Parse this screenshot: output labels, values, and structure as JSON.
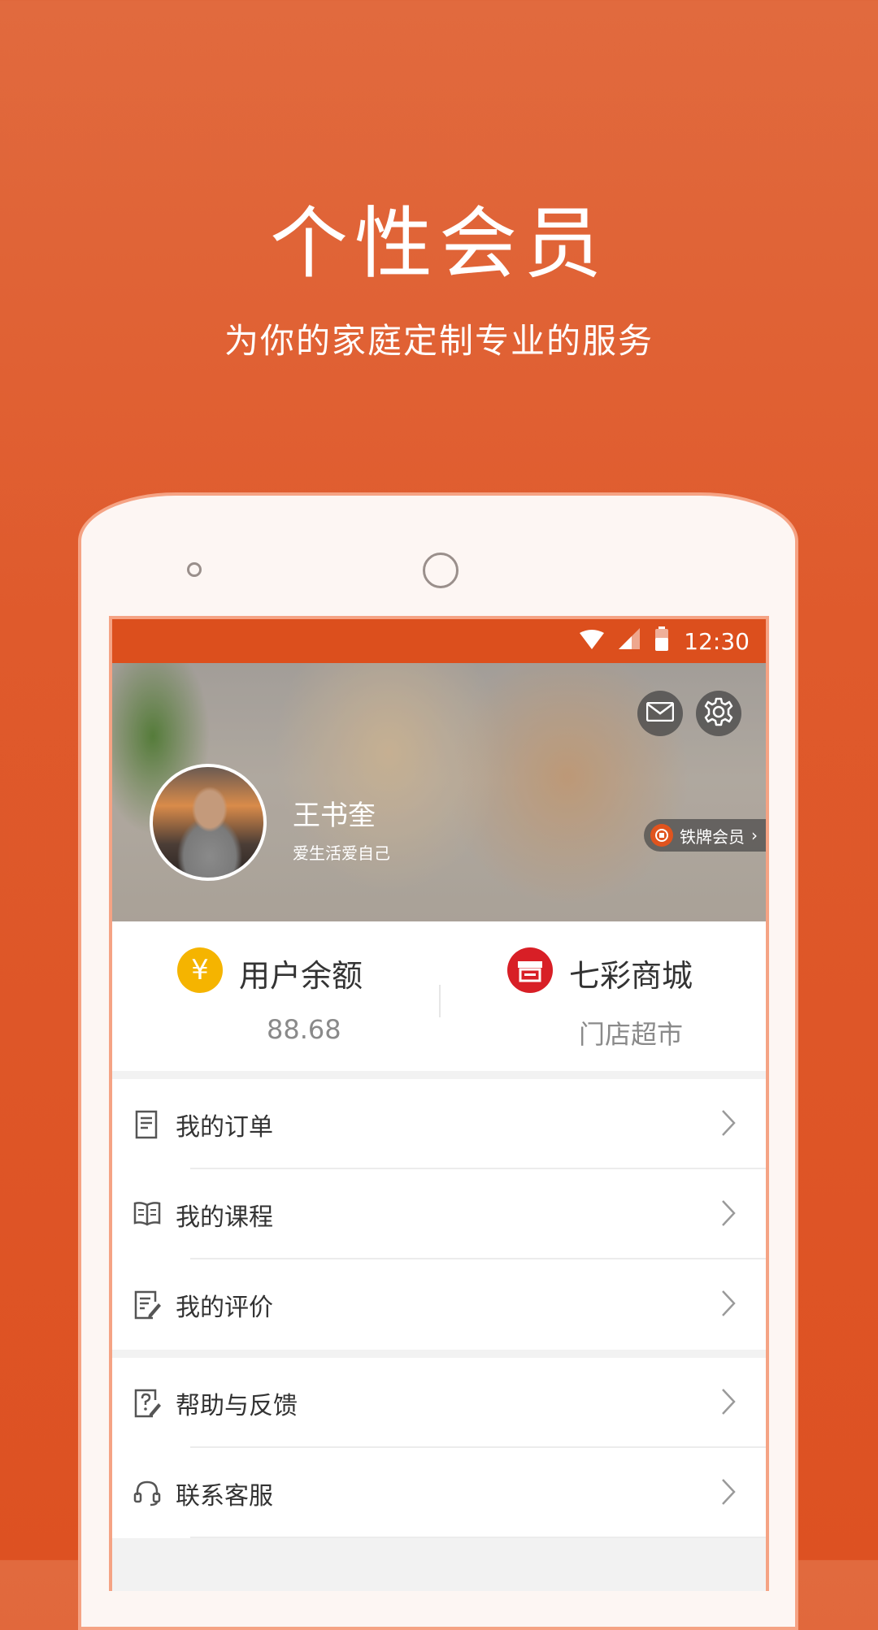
{
  "promo": {
    "title": "个性会员",
    "subtitle": "为你的家庭定制专业的服务"
  },
  "status_bar": {
    "time": "12:30"
  },
  "profile": {
    "name": "王书奎",
    "motto": "爱生活爱自己",
    "member_level": "铁牌会员",
    "member_chevron": "›"
  },
  "stats": {
    "balance": {
      "title": "用户余额",
      "value": "88.68",
      "icon": "yen-icon",
      "icon_text": "¥"
    },
    "mall": {
      "title": "七彩商城",
      "value": "门店超市",
      "icon": "store-icon"
    }
  },
  "menu": {
    "group1": [
      {
        "label": "我的订单",
        "icon": "order-icon"
      },
      {
        "label": "我的课程",
        "icon": "book-icon"
      },
      {
        "label": "我的评价",
        "icon": "review-icon"
      }
    ],
    "group2": [
      {
        "label": "帮助与反馈",
        "icon": "help-icon"
      },
      {
        "label": "联系客服",
        "icon": "headset-icon"
      }
    ]
  },
  "colors": {
    "brand": "#dc4f1d",
    "balance_icon": "#f5b400",
    "mall_icon": "#d81f26"
  }
}
